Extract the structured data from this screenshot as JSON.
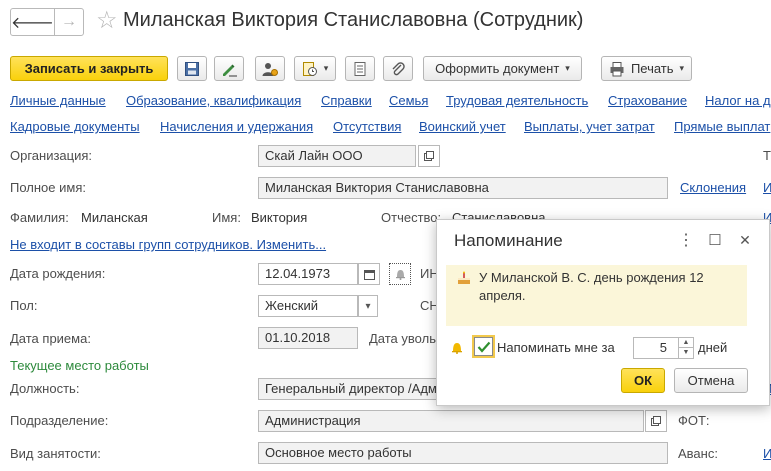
{
  "window": {
    "title": "Миланская Виктория Станиславовна (Сотрудник)",
    "back_glyph": "🡐",
    "forward_glyph": "→",
    "favorite_glyph": "☆"
  },
  "toolbar": {
    "save_close_label": "Записать и закрыть",
    "create_document_label": "Оформить документ",
    "print_label": "Печать",
    "caret": "▾"
  },
  "tabs_row1": [
    "Личные данные",
    "Образование, квалификация",
    "Справки",
    "Семья",
    "Трудовая деятельность",
    "Страхование",
    "Налог на д"
  ],
  "tabs_row2": [
    "Кадровые документы",
    "Начисления и удержания",
    "Отсутствия",
    "Воинский учет",
    "Выплаты, учет затрат",
    "Прямые выплат"
  ],
  "form": {
    "organization": {
      "label": "Организация:",
      "value": "Скай Лайн ООО"
    },
    "full_name": {
      "label": "Полное имя:",
      "value": "Миланская Виктория Станиславовна",
      "declension_link": "Склонения"
    },
    "surname": {
      "label": "Фамилия:",
      "value": "Миланская"
    },
    "name": {
      "label": "Имя:",
      "value": "Виктория"
    },
    "patronymic": {
      "label": "Отчество:",
      "value": "Станиславовна"
    },
    "groups_link": "Не входит в составы групп сотрудников. Изменить...",
    "birth_date": {
      "label": "Дата рождения:",
      "value": "12.04.1973",
      "inn_label": "ИН"
    },
    "gender": {
      "label": "Пол:",
      "value": "Женский",
      "snils_label": "СН"
    },
    "hire_date": {
      "label": "Дата приема:",
      "value": "01.10.2018",
      "dismiss_label": "Дата уволь"
    },
    "current_job_header": "Текущее место работы",
    "position": {
      "label": "Должность:",
      "value": "Генеральный директор /Адм"
    },
    "department": {
      "label": "Подразделение:",
      "value": "Администрация",
      "fot_label": "ФОТ:"
    },
    "employment_type": {
      "label": "Вид занятости:",
      "value": "Основное место работы",
      "advance_label": "Аванс:"
    },
    "right_edge": {
      "t": "Т",
      "i1": "И",
      "i2": "И",
      "i3": "И",
      "i4": "И"
    }
  },
  "dialog": {
    "title": "Напоминание",
    "message": "У Миланской В. С. день рождения 12 апреля.",
    "remind_label": "Напоминать мне за",
    "remind_checked": true,
    "days_value": "5",
    "days_label": "дней",
    "ok_label": "ОК",
    "cancel_label": "Отмена",
    "menu_glyph": "⋮",
    "maximize_glyph": "☐",
    "close_glyph": "✕"
  },
  "colors": {
    "accent_yellow": "#f9d10b",
    "link_blue": "#1c50a8",
    "section_green": "#2d8a3c",
    "note_background": "#fbf6d9"
  }
}
